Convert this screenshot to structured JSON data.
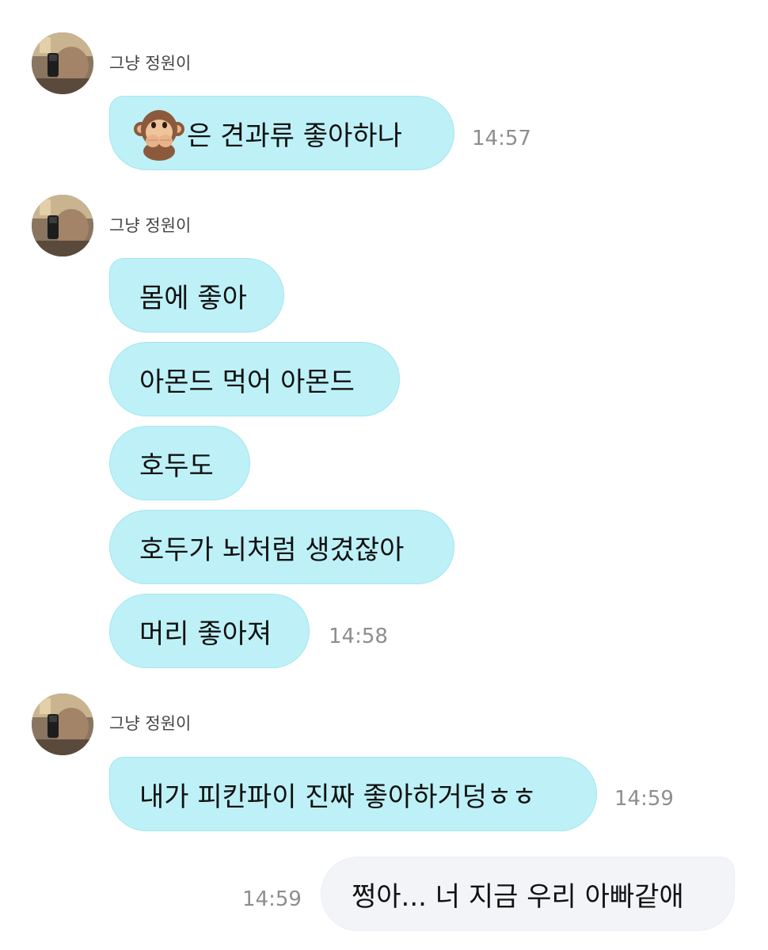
{
  "chat": {
    "sender_name": "그냥 정원이",
    "groups": [
      {
        "sender": "그냥 정원이",
        "messages": [
          {
            "emoji": "see-no-evil monkey (hands over mouth)",
            "text": "은 견과류 좋아하나"
          }
        ],
        "time": "14:57"
      },
      {
        "sender": "그냥 정원이",
        "messages": [
          {
            "text": "몸에 좋아"
          },
          {
            "text": "아몬드 먹어 아몬드"
          },
          {
            "text": "호두도"
          },
          {
            "text": "호두가 뇌처럼 생겼잖아"
          },
          {
            "text": "머리 좋아져"
          }
        ],
        "time": "14:58"
      },
      {
        "sender": "그냥 정원이",
        "messages": [
          {
            "text": "내가 피칸파이 진짜 좋아하거덩ㅎㅎ"
          }
        ],
        "time": "14:59"
      }
    ],
    "outgoing": {
      "text": "쩡아... 너 지금 우리 아빠같애",
      "time": "14:59"
    }
  },
  "colors": {
    "incoming_bubble": "#bdf1f7",
    "outgoing_bubble": "#f3f4f8",
    "timestamp": "#8e8e8e",
    "sender_name": "#444444"
  },
  "icons": {
    "avatar": "profile-photo",
    "emoji": "monkey-speak-no-evil"
  }
}
